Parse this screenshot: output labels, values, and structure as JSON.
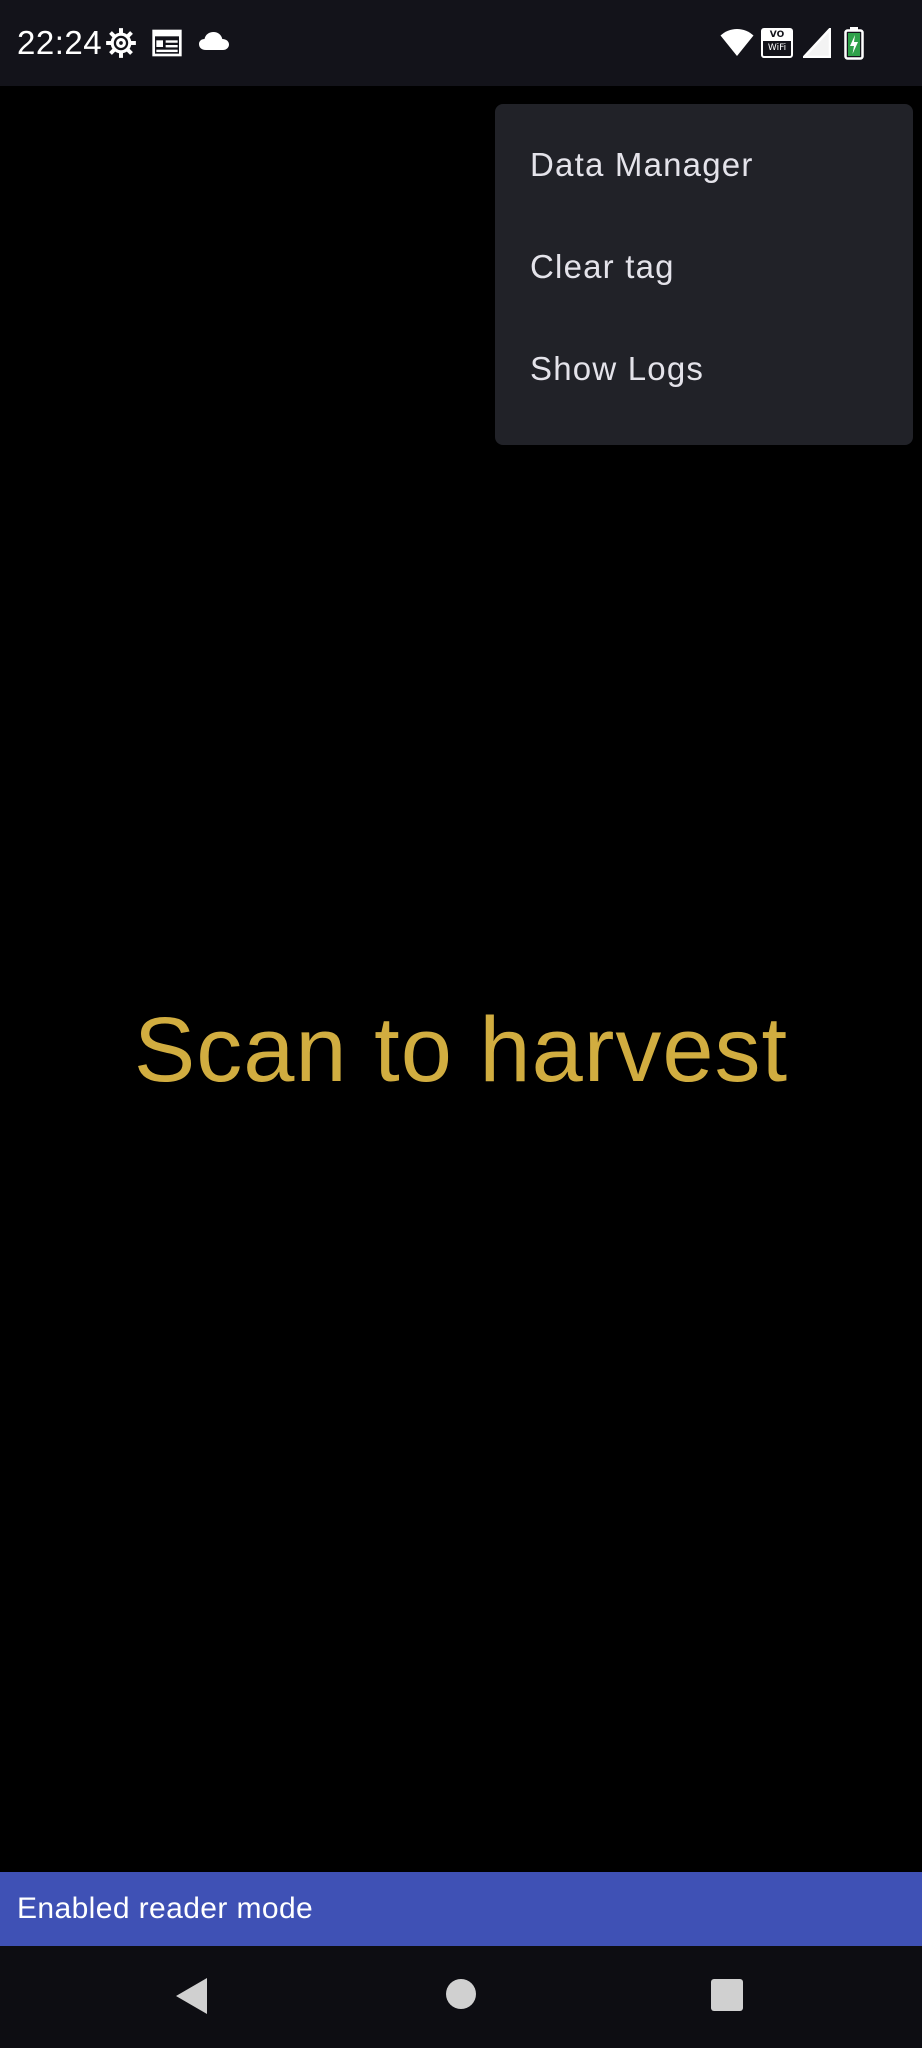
{
  "status_bar": {
    "time": "22:24",
    "left_icons": [
      "settings-gear-icon",
      "calendar-icon",
      "cloud-icon"
    ],
    "right_icons": [
      "wifi-icon",
      "vowifi-icon",
      "cell-signal-icon",
      "battery-charging-icon"
    ],
    "vowifi_top": "VO",
    "vowifi_bottom": "WiFi"
  },
  "menu": {
    "items": [
      {
        "label": "Data Manager"
      },
      {
        "label": "Clear tag"
      },
      {
        "label": "Show Logs"
      }
    ]
  },
  "main": {
    "prompt": "Scan to harvest",
    "prompt_color": "#d1ad40"
  },
  "snackbar": {
    "message": "Enabled reader mode",
    "color": "#3f51b5"
  },
  "nav_bar": {
    "buttons": [
      "back-icon",
      "home-icon",
      "recents-icon"
    ]
  }
}
